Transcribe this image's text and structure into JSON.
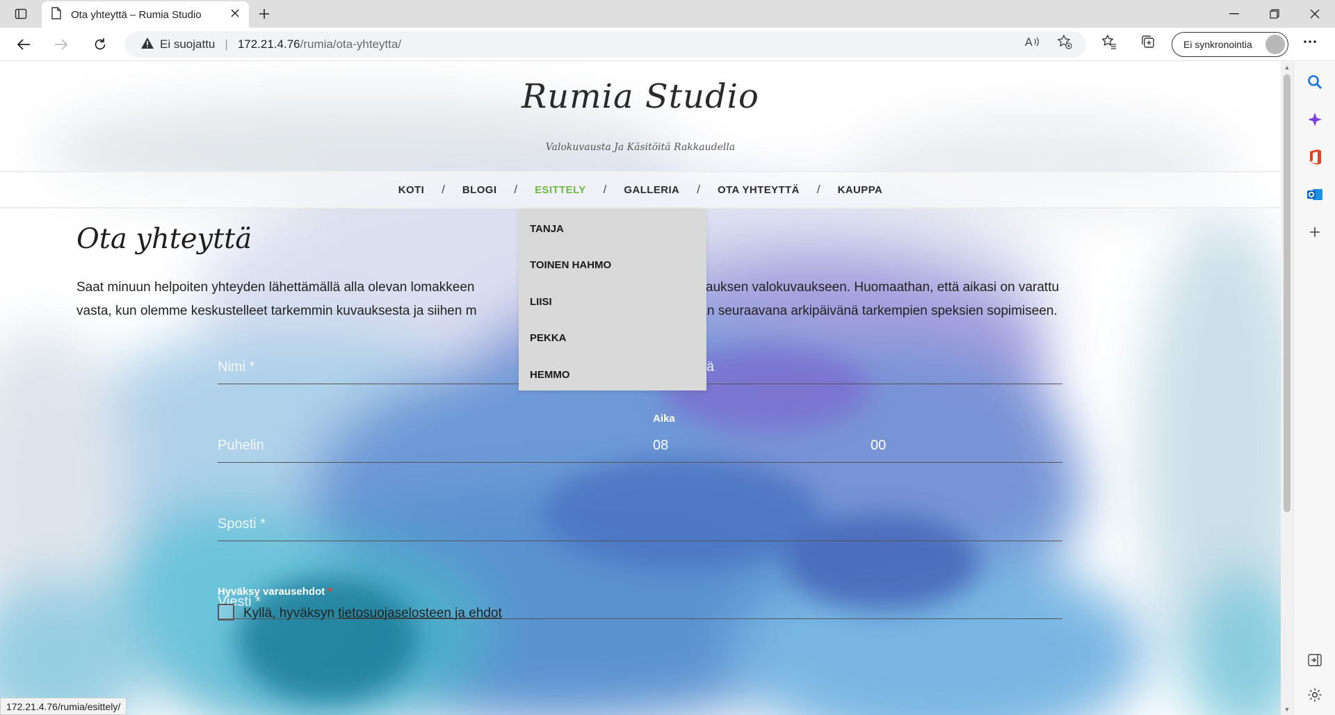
{
  "browser": {
    "tab_title": "Ota yhteyttä – Rumia Studio",
    "security_label": "Ei suojattu",
    "url_host": "172.21.4.76",
    "url_path": "/rumia/ota-yhteytta/",
    "sync_label": "Ei synkronointia",
    "status_url": "172.21.4.76/rumia/esittely/"
  },
  "site": {
    "title": "Rumia Studio",
    "tagline": "Valokuvausta Ja Käsitöitä Rakkaudella"
  },
  "nav": {
    "items": [
      {
        "label": "KOTI",
        "active": false
      },
      {
        "label": "BLOGI",
        "active": false
      },
      {
        "label": "ESITTELY",
        "active": true
      },
      {
        "label": "GALLERIA",
        "active": false
      },
      {
        "label": "OTA YHTEYTTÄ",
        "active": false
      },
      {
        "label": "KAUPPA",
        "active": false
      }
    ],
    "dropdown": [
      "TANJA",
      "TOINEN HAHMO",
      "LIISI",
      "PEKKA",
      "HEMMO"
    ]
  },
  "page": {
    "heading": "Ota yhteyttä",
    "intro_line1a": "Saat minuun helpoiten yhteyden lähettämällä alla olevan lomakkeen",
    "intro_line1b": "i alustavan varauksen valokuvaukseen. Huomaathan, että aikasi on varattu",
    "intro_line2a": "vasta, kun olemme keskustelleet tarkemmin kuvauksesta ja siihen m",
    "intro_line2b": "että viimeistään seuraavana arkipäivänä tarkempien speksien sopimiseen."
  },
  "form": {
    "name_label": "Nimi *",
    "date_label_fragment": "ä",
    "phone_label": "Puhelin",
    "time_label": "Aika",
    "time_hours": "08",
    "time_minutes": "00",
    "email_label": "Sposti *",
    "message_label": "Viesti *",
    "terms_heading": "Hyväksy varausehdot",
    "terms_required_mark": "*",
    "checkbox_text": "Kyllä, hyväksyn",
    "checkbox_link": "tietosuojaselosteen ja ehdot"
  },
  "colors": {
    "nav_active": "#6dbb43",
    "dropdown_bg": "#d9d9d9"
  }
}
